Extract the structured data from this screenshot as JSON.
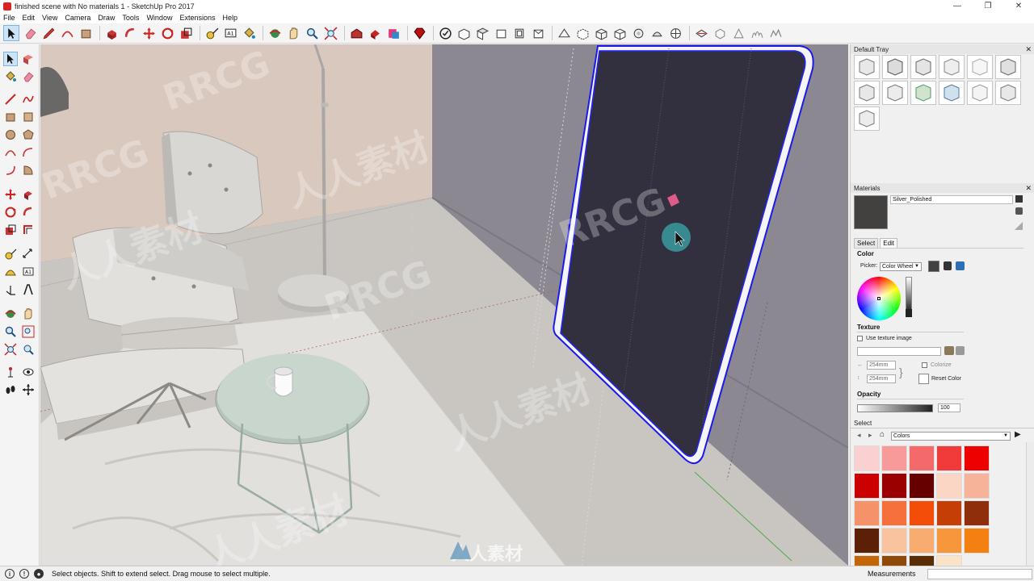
{
  "window": {
    "title": "finished scene with No materials 1 - SketchUp Pro 2017",
    "controls": [
      "—",
      "❐",
      "✕"
    ]
  },
  "menu": [
    "File",
    "Edit",
    "View",
    "Camera",
    "Draw",
    "Tools",
    "Window",
    "Extensions",
    "Help"
  ],
  "toolbar": {
    "icons": [
      "select-icon",
      "eraser-icon",
      "pencil-icon",
      "arc-icon",
      "rectangle-icon",
      "push-pull-icon",
      "follow-me-icon",
      "move-icon",
      "rotate-icon",
      "scale-icon",
      "tape-measure-icon",
      "text-icon",
      "paint-bucket-icon",
      "orbit-icon",
      "pan-icon",
      "zoom-icon",
      "zoom-extents-icon",
      "warehouse-icon",
      "extension-warehouse-icon",
      "layout-icon",
      "ruby-icon",
      "component-icon",
      "views-iso-icon",
      "views-top-icon",
      "views-front-icon",
      "views-right-icon",
      "views-back-icon",
      "views-left-icon",
      "x-ray-icon",
      "back-edges-icon",
      "wireframe-icon",
      "hidden-line-icon",
      "shaded-icon",
      "shaded-textures-icon",
      "monochrome-icon",
      "section-plane-icon",
      "section-display-icon",
      "shadows-icon",
      "fog-icon",
      "sandbox-icon",
      "terrain-icon"
    ]
  },
  "tray": {
    "title": "Default Tray",
    "materials_title": "Materials",
    "material_name": "Silver_Polished",
    "material_color": "#424140",
    "tabs": [
      "Select",
      "Edit"
    ],
    "color_label": "Color",
    "picker_label": "Picker:",
    "picker_value": "Color Wheel",
    "texture_label": "Texture",
    "use_texture_label": "Use texture image",
    "width_value": "254mm",
    "height_value": "254mm",
    "colorize_label": "Colorize",
    "reset_color_label": "Reset Color",
    "opacity_label": "Opacity",
    "opacity_value": "100",
    "select_label": "Select",
    "collection_value": "Colors",
    "palette": [
      "#fbd0d0",
      "#f99a9a",
      "#f46a6a",
      "#f13a3a",
      "#ee0000",
      "#cc0000",
      "#9a0000",
      "#660000",
      "#fbd6c4",
      "#f7b39a",
      "#f6926a",
      "#f5703a",
      "#f44d0a",
      "#c43e06",
      "#8e2e0a",
      "#5c2006",
      "#f9c3a0",
      "#f8ac70",
      "#f7963a",
      "#f38010",
      "#c36608",
      "#8e4a06",
      "#5a2e04",
      "#fbe3c8"
    ]
  },
  "status": {
    "message": "Select objects. Shift to extend select. Drag mouse to select multiple.",
    "measurements_label": "Measurements"
  },
  "watermarks": [
    "RRCG",
    "人人素材",
    "RRCG",
    "人人素材",
    "RRCG",
    "人人素材",
    "RRCG",
    "人人素材"
  ],
  "logo_text": "人人素材"
}
